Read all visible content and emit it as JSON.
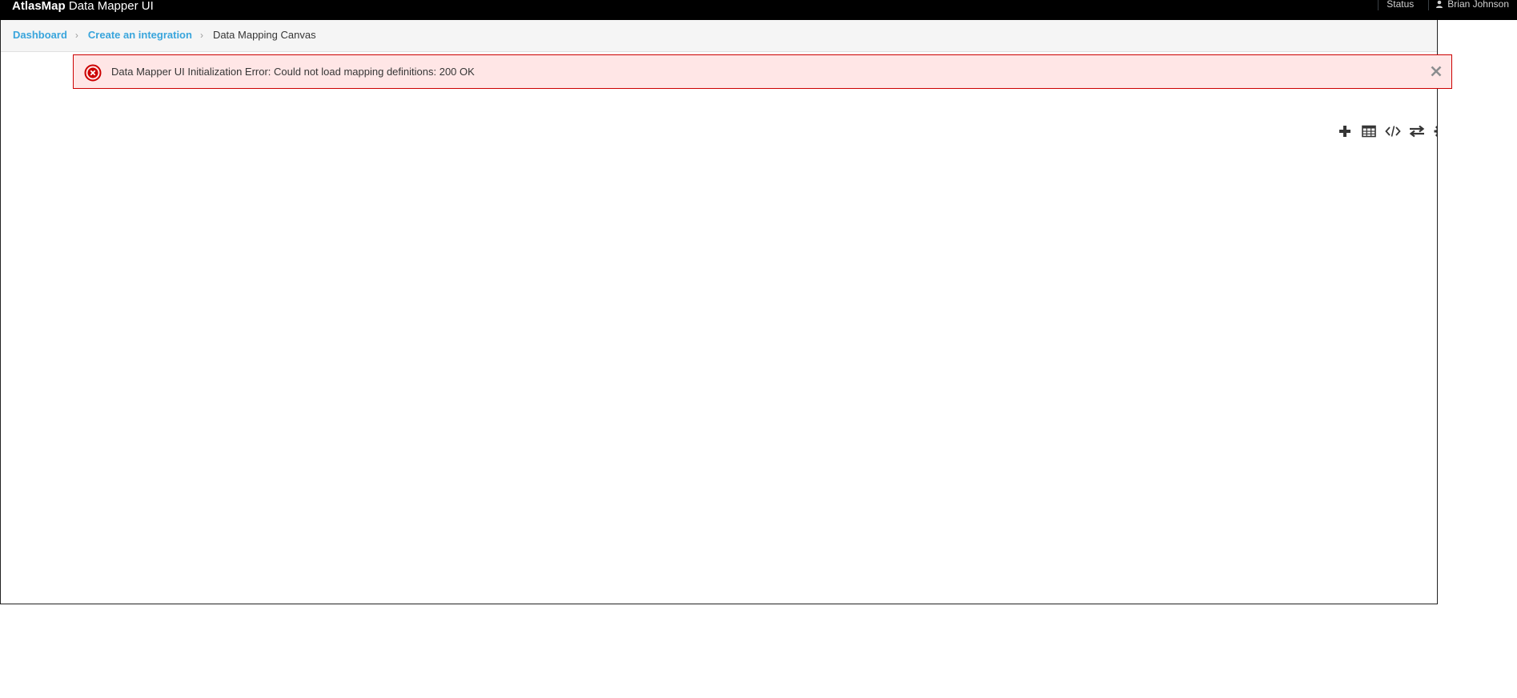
{
  "header": {
    "brand_strong": "AtlasMap",
    "brand_rest": " Data Mapper UI",
    "status_label": "Status",
    "user_name": "Brian Johnson"
  },
  "breadcrumb": {
    "items": [
      {
        "label": "Dashboard",
        "link": true
      },
      {
        "label": "Create an integration",
        "link": true
      },
      {
        "label": "Data Mapping Canvas",
        "link": false
      }
    ]
  },
  "alert": {
    "type": "error",
    "message": "Data Mapper UI Initialization Error: Could not load mapping definitions: 200 OK",
    "icon": "error-circle-icon",
    "close_icon": "close-icon"
  },
  "toolbar": {
    "buttons": [
      {
        "icon": "plus-icon",
        "title": "Add new mapping"
      },
      {
        "icon": "table-icon",
        "title": "Show mapping table"
      },
      {
        "icon": "code-icon",
        "title": "Show namespace table"
      },
      {
        "icon": "exchange-icon",
        "title": "Show / hide mapping lines"
      },
      {
        "icon": "gear-icon",
        "title": "Settings"
      }
    ]
  },
  "colors": {
    "topbar_bg": "#000000",
    "breadcrumb_link": "#39a5dc",
    "alert_bg": "#ffe6e6",
    "alert_border": "#cc0000",
    "toolbar_icon": "#363636"
  }
}
